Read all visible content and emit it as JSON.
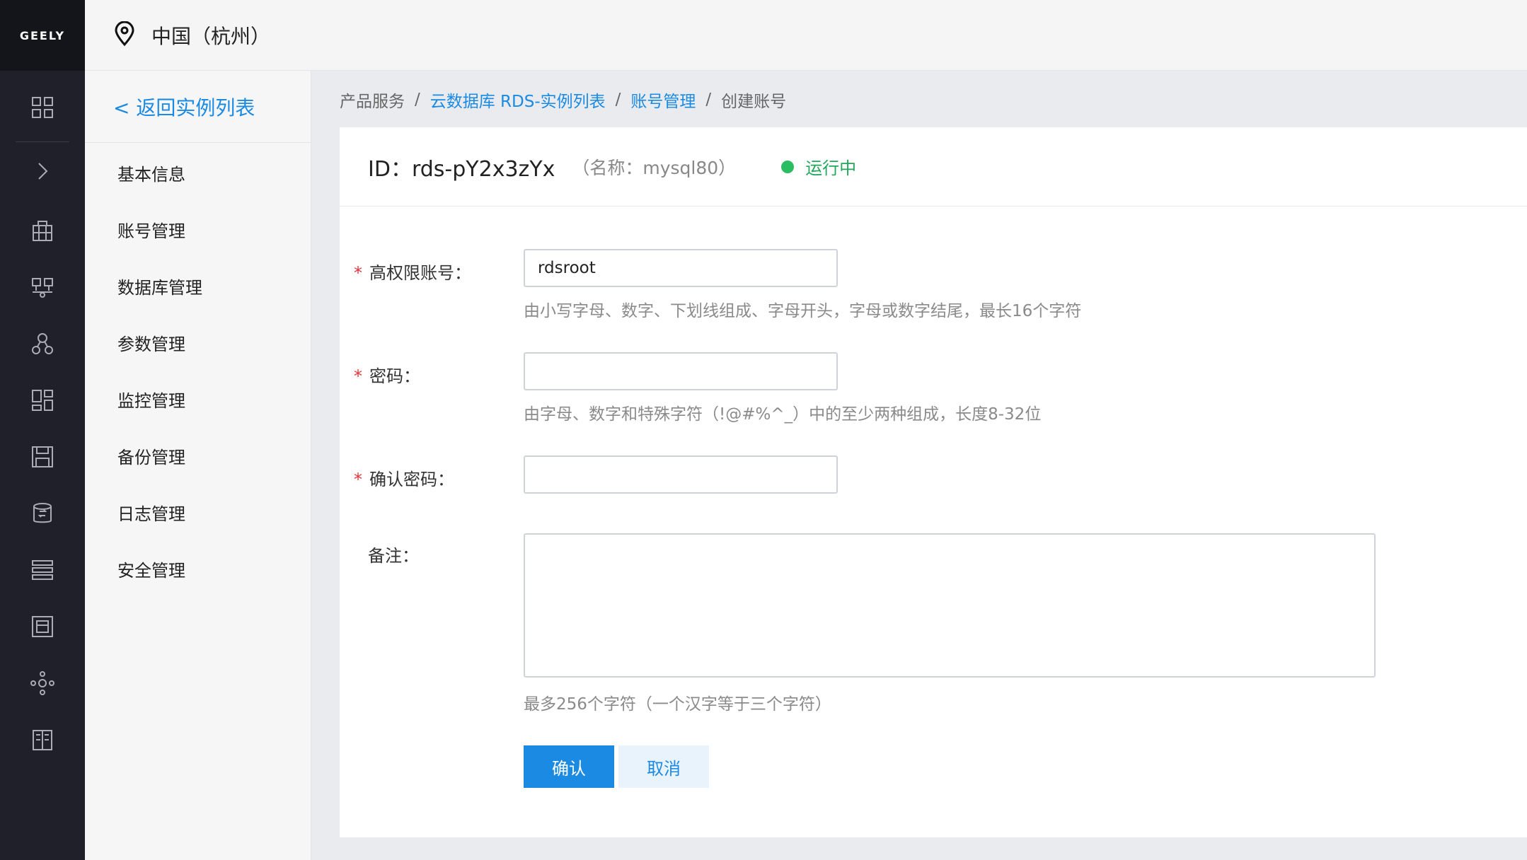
{
  "brand": {
    "logo_text": "GEELY"
  },
  "rail_icons": [
    "grid-icon",
    "chevron-right-icon",
    "building-icon",
    "network-icon",
    "cluster-icon",
    "dashboard-icon",
    "save-icon",
    "database-icon",
    "list-icon",
    "frame-icon",
    "nodes-icon",
    "server-icon"
  ],
  "topbar": {
    "region": "中国（杭州）"
  },
  "subnav": {
    "back_label": "< 返回实例列表",
    "items": [
      "基本信息",
      "账号管理",
      "数据库管理",
      "参数管理",
      "监控管理",
      "备份管理",
      "日志管理",
      "安全管理"
    ]
  },
  "breadcrumb": {
    "root": "产品服务",
    "level1": "云数据库 RDS-实例列表",
    "level2": "账号管理",
    "current": "创建账号",
    "separator": "/"
  },
  "instance": {
    "id_text": "ID：rds-pY2x3zYx",
    "name_text": "（名称：mysql80）",
    "status": "运行中"
  },
  "form": {
    "account": {
      "label": "高权限账号：",
      "value": "rdsroot",
      "hint": "由小写字母、数字、下划线组成、字母开头，字母或数字结尾，最长16个字符"
    },
    "password": {
      "label": "密码：",
      "value": "",
      "hint": "由字母、数字和特殊字符（!@#%^_）中的至少两种组成，长度8-32位"
    },
    "confirm_password": {
      "label": "确认密码：",
      "value": ""
    },
    "remark": {
      "label": "备注：",
      "hint": "最多256个字符（一个汉字等于三个字符）"
    },
    "required_mark": "*",
    "confirm_label": "确认",
    "cancel_label": "取消"
  },
  "colors": {
    "accent": "#1b8ae2",
    "status_green": "#2bbd62",
    "rail_bg": "#1f2029",
    "required": "#e8333a"
  }
}
